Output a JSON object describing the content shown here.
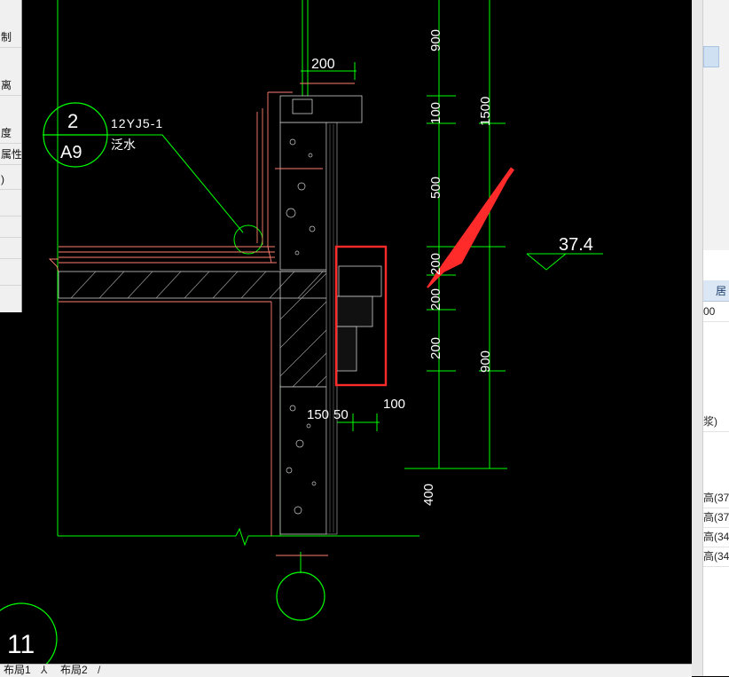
{
  "colors": {
    "background": "#000000",
    "outline": "#00ff00",
    "wall": "#ff7f6e",
    "text": "#ffffff",
    "annotation": "#ff2a2a"
  },
  "left_panel": {
    "items": [
      "制",
      "离",
      "度",
      "属性",
      ")"
    ]
  },
  "drawing": {
    "detail_ref": {
      "number": "2",
      "sheet": "A9",
      "standard": "12YJ5-1",
      "name": "泛水"
    },
    "dims_top": {
      "width": "200"
    },
    "dims_bottom": {
      "left": "150",
      "mid": "50",
      "right": "100"
    },
    "dims_vertical_inner": [
      "900",
      "100",
      "500",
      "200",
      "200",
      "200"
    ],
    "dims_vertical_outer": [
      "1500",
      "900"
    ],
    "dim_400": "400",
    "elevation": "37.4",
    "axis_label": "11"
  },
  "icons": [
    "detail-callout-icon",
    "axis-bubble-icon",
    "elevation-marker-icon",
    "red-arrow-icon",
    "break-line-icon"
  ],
  "right_panel": {
    "header": "居",
    "value": "00",
    "label1": "浆)",
    "rows": [
      "高(37",
      "高(37",
      "高(34",
      "高(34"
    ]
  },
  "tabs": [
    "布局1",
    "布局2"
  ]
}
